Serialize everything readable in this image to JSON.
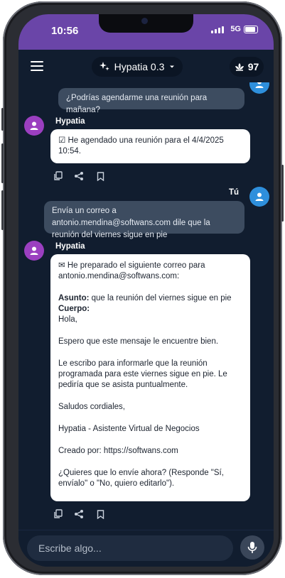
{
  "status_bar": {
    "time": "10:56",
    "network": "5G"
  },
  "header": {
    "model_label": "Hypatia 0.3",
    "credits": "97"
  },
  "messages": {
    "user_1": "¿Podrías agendarme una reunión para mañana?",
    "bot_1": {
      "sender": "Hypatia",
      "text": "☑ He agendado una reunión para el 4/4/2025 10:54."
    },
    "user_2": {
      "sender": "Tú",
      "text": "Envía un correo a antonio.mendina@softwans.com dile que la reunión del viernes sigue en pie"
    },
    "bot_2": {
      "sender": "Hypatia",
      "intro": "✉ He preparado el siguiente correo para antonio.mendina@softwans.com:",
      "subject_label": "Asunto:",
      "subject": " que la reunión del viernes sigue en pie",
      "body_label": "Cuerpo:",
      "greeting": "Hola,",
      "p1": "Espero que este mensaje le encuentre bien.",
      "p2": "Le escribo para informarle que la reunión programada para este viernes sigue en pie. Le pediría que se asista puntualmente.",
      "closing": "Saludos cordiales,",
      "signature": "Hypatia - Asistente Virtual de Negocios",
      "created_by": "Creado por: https://softwans.com",
      "question": "¿Quieres que lo envíe ahora? (Responde \"Sí, envíalo\" o \"No, quiero editarlo\")."
    }
  },
  "input": {
    "placeholder": "Escribe algo..."
  },
  "colors": {
    "accent": "#6a45a8",
    "background": "#111d2f",
    "user_bubble": "#3d4c60",
    "bot_avatar": "#9b3fc0",
    "user_avatar": "#2e8fdc"
  },
  "icons": [
    "menu-icon",
    "sparkle-icon",
    "chevron-down-icon",
    "lotus-icon",
    "copy-icon",
    "share-icon",
    "bookmark-icon",
    "person-icon",
    "mic-icon"
  ]
}
